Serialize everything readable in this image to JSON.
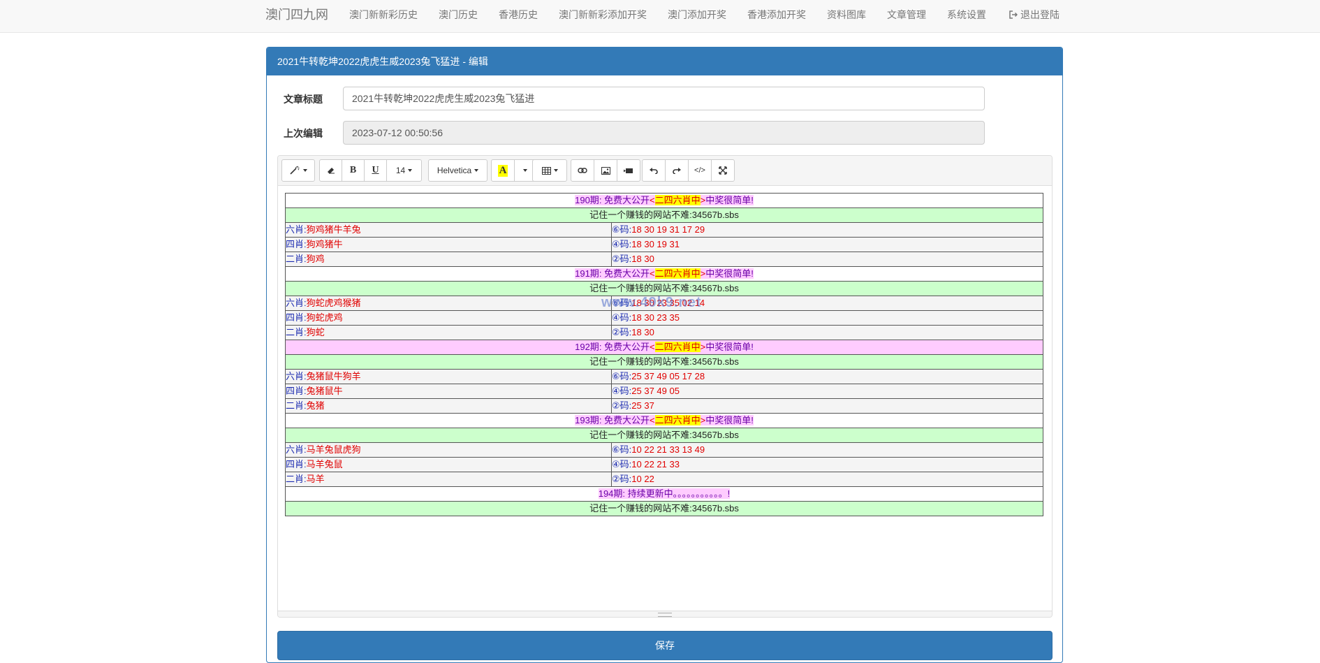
{
  "navbar": {
    "brand": "澳门四九网",
    "links": [
      "澳门新新彩历史",
      "澳门历史",
      "香港历史",
      "澳门新新彩添加开奖",
      "澳门添加开奖",
      "香港添加开奖",
      "资料图库",
      "文章管理",
      "系统设置"
    ],
    "logout": "退出登陆"
  },
  "panel": {
    "title": "2021牛转乾坤2022虎虎生威2023兔飞猛进 - 编辑"
  },
  "form": {
    "title_label": "文章标题",
    "title_value": "2021牛转乾坤2022虎虎生威2023兔飞猛进",
    "edited_label": "上次编辑",
    "edited_value": "2023-07-12 00:50:56"
  },
  "toolbar": {
    "font_size": "14",
    "font_name": "Helvetica",
    "bold": "B",
    "underline": "U",
    "forecolor_glyph": "A",
    "codeview": "</>",
    "colors": {
      "forecolor_bg": "#ffff00",
      "accent": "#337ab7"
    }
  },
  "content": {
    "slogan": "记住一个赚钱的网站不难:34567b.sbs",
    "watermark": "www.49k9.net",
    "header_parts": {
      "mid": ": 免费大公开",
      "lt": "<",
      "tag": "二四六肖中",
      "gt": ">",
      "tail": "中奖很简单!"
    },
    "rounds": [
      {
        "period": "190期",
        "rows": [
          {
            "prefix": "六肖:",
            "animals": "狗鸡猪牛羊兔",
            "circle": "⑥",
            "code_label": "码:",
            "numbers": "18 30 19 31 17 29"
          },
          {
            "prefix": "四肖:",
            "animals": "狗鸡猪牛",
            "circle": "④",
            "code_label": "码:",
            "numbers": "18 30 19 31"
          },
          {
            "prefix": "二肖:",
            "animals": "狗鸡",
            "circle": "②",
            "code_label": "码:",
            "numbers": "18 30"
          }
        ]
      },
      {
        "period": "191期",
        "rows": [
          {
            "prefix": "六肖:",
            "animals": "狗蛇虎鸡猴猪",
            "circle": "⑥",
            "code_label": "码:",
            "numbers": "18 30 23 35 02 14"
          },
          {
            "prefix": "四肖:",
            "animals": "狗蛇虎鸡",
            "circle": "④",
            "code_label": "码:",
            "numbers": "18 30 23 35"
          },
          {
            "prefix": "二肖:",
            "animals": "狗蛇",
            "circle": "②",
            "code_label": "码:",
            "numbers": "18 30"
          }
        ]
      },
      {
        "period": "192期",
        "rows": [
          {
            "prefix": "六肖:",
            "animals": "兔猪鼠牛狗羊",
            "circle": "⑥",
            "code_label": "码:",
            "numbers": "25 37 49 05 17 28"
          },
          {
            "prefix": "四肖:",
            "animals": "兔猪鼠牛",
            "circle": "④",
            "code_label": "码:",
            "numbers": "25 37 49 05"
          },
          {
            "prefix": "二肖:",
            "animals": "兔猪",
            "circle": "②",
            "code_label": "码:",
            "numbers": "25 37"
          }
        ]
      },
      {
        "period": "193期",
        "rows": [
          {
            "prefix": "六肖:",
            "animals": "马羊兔鼠虎狗",
            "circle": "⑥",
            "code_label": "码:",
            "numbers": "10 22 21 33 13 49"
          },
          {
            "prefix": "四肖:",
            "animals": "马羊兔鼠",
            "circle": "④",
            "code_label": "码:",
            "numbers": "10 22 21 33"
          },
          {
            "prefix": "二肖:",
            "animals": "马羊",
            "circle": "②",
            "code_label": "码:",
            "numbers": "10 22"
          }
        ]
      }
    ],
    "last_period": "194期",
    "last_text": ": 持续更新中。。。。。。。。。。。!"
  },
  "save_label": "保存"
}
